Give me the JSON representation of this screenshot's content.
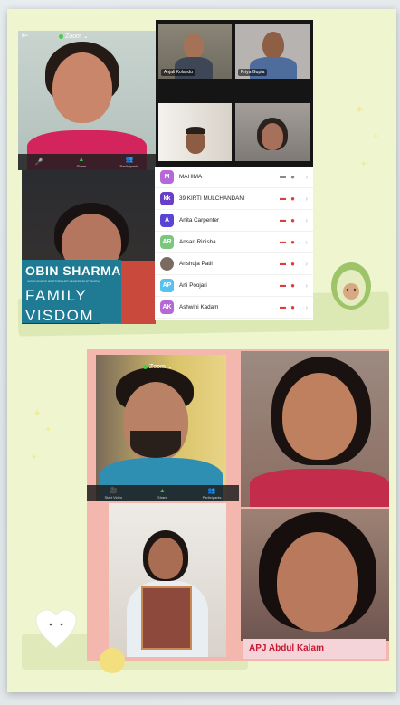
{
  "top_meeting": {
    "zoom_label": "Zoom",
    "zoom_chevron": "⌄",
    "back_glyph": "⇤",
    "tiles": [
      {
        "id": "mahima",
        "label": ""
      },
      {
        "id": "anjali",
        "label": "Anjali Kolandu"
      },
      {
        "id": "priya",
        "label": "Priya Gupta"
      }
    ],
    "toolbar": {
      "items": [
        {
          "label": "",
          "glyph": "🎤"
        },
        {
          "label": "Share",
          "glyph": "▲"
        },
        {
          "label": "Participants",
          "glyph": "👥"
        }
      ]
    },
    "book": {
      "author": "OBIN SHARMA",
      "subtitle": "WORLDWIDE BESTSELLER LEADERSHIP GURU",
      "title_line1": "FAMILY",
      "title_line2": "VISDOM"
    },
    "participants": [
      {
        "initials": "M",
        "name": "MAHIMA",
        "color": "#b569d6",
        "mic": "grey",
        "cam": "grey"
      },
      {
        "initials": "kk",
        "name": "39 KIRTI MULCHANDANI",
        "color": "#6a3fc8",
        "mic": "red",
        "cam": "red"
      },
      {
        "initials": "A",
        "name": "Anita Carpenter",
        "color": "#5a44d4",
        "mic": "red",
        "cam": "red"
      },
      {
        "initials": "AR",
        "name": "Ansari Rinisha",
        "color": "#7cc77f",
        "mic": "red",
        "cam": "red"
      },
      {
        "initials": "",
        "name": "Anshuja Patil",
        "color": "#7a6b60",
        "mic": "red",
        "cam": "red"
      },
      {
        "initials": "AP",
        "name": "Arti Poojari",
        "color": "#59c1ee",
        "mic": "red",
        "cam": "red"
      },
      {
        "initials": "AK",
        "name": "Ashwini Kadam",
        "color": "#b569d6",
        "mic": "red",
        "cam": "red"
      }
    ],
    "chevron": "›"
  },
  "bottom_meeting": {
    "zoom_label": "Zoom",
    "zoom_chevron": "⌄",
    "toolbar": {
      "items": [
        {
          "label": "Start Video",
          "glyph": "🎥"
        },
        {
          "label": "Share",
          "glyph": "▲"
        },
        {
          "label": "Participants",
          "glyph": "👥"
        }
      ]
    },
    "apj_banner": "APJ Abdul Kalam"
  },
  "colors": {
    "card_bg": "#eef5cf",
    "accent_red": "#e03a3a",
    "zoom_green": "#3fd13f"
  }
}
